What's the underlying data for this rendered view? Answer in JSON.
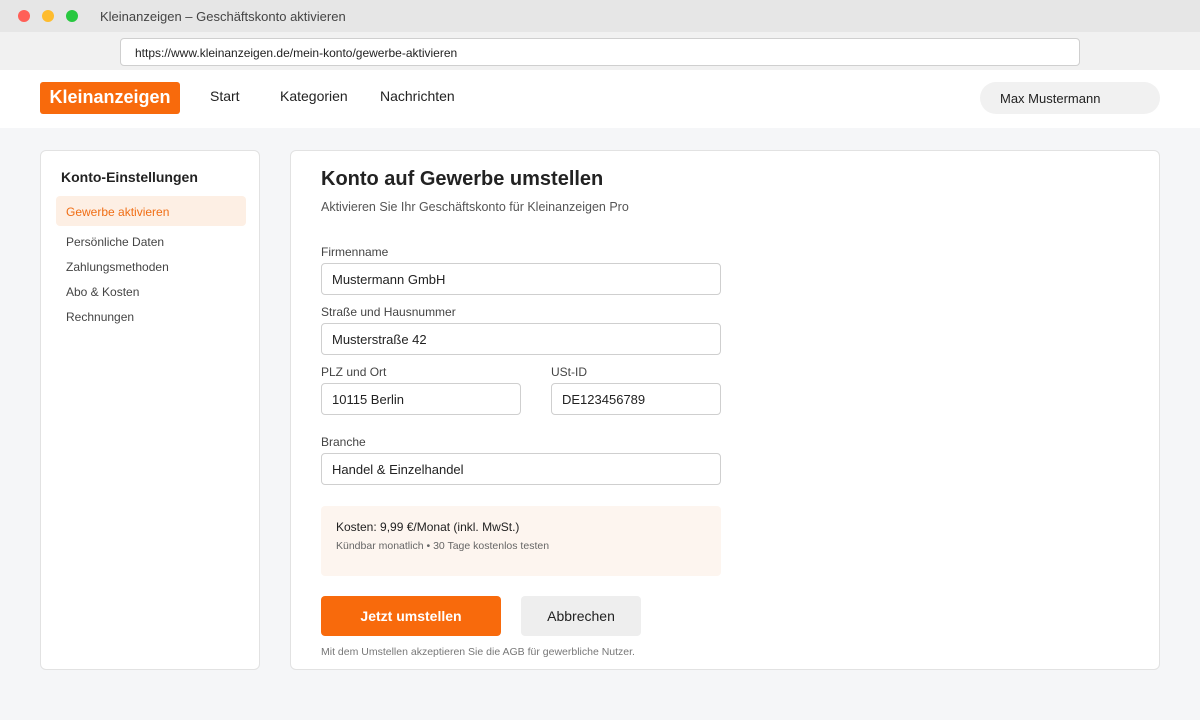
{
  "window": {
    "title": "Kleinanzeigen – Geschäftskonto aktivieren",
    "url": "https://www.kleinanzeigen.de/mein-konto/gewerbe-aktivieren"
  },
  "header": {
    "logo": "Kleinanzeigen",
    "nav": [
      "Start",
      "Kategorien",
      "Nachrichten"
    ],
    "user": "Max Mustermann"
  },
  "sidebar": {
    "title": "Konto-Einstellungen",
    "active_item": "Gewerbe aktivieren",
    "items": [
      "Persönliche Daten",
      "Zahlungsmethoden",
      "Abo & Kosten",
      "Rechnungen"
    ]
  },
  "main": {
    "title": "Konto auf Gewerbe umstellen",
    "subtitle": "Aktivieren Sie Ihr Geschäftskonto für Kleinanzeigen Pro",
    "fields": {
      "firmenname": {
        "label": "Firmenname",
        "value": "Mustermann GmbH"
      },
      "strasse": {
        "label": "Straße und Hausnummer",
        "value": "Musterstraße 42"
      },
      "plz_ort": {
        "label": "PLZ und Ort",
        "value": "10115 Berlin"
      },
      "ust_id": {
        "label": "USt-ID",
        "value": "DE123456789"
      },
      "branche": {
        "label": "Branche",
        "value": "Handel & Einzelhandel"
      }
    },
    "cost": {
      "main": "Kosten: 9,99 €/Monat (inkl. MwSt.)",
      "sub": "Kündbar monatlich • 30 Tage kostenlos testen"
    },
    "primary_button": "Jetzt umstellen",
    "secondary_button": "Abbrechen",
    "footnote": "Mit dem Umstellen akzeptieren Sie die AGB für gewerbliche Nutzer."
  },
  "colors": {
    "brand": "#f86a0c",
    "active_bg": "#fdefe4",
    "cost_bg": "#fdf5ef"
  }
}
